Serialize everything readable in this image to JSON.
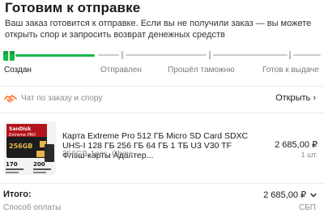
{
  "header": {
    "title": "Готовим к отправке",
    "subtitle": "Ваш заказ готовится к отправке. Если вы не получили заказ — вы можете открыть спор и запросить возврат денежных средств"
  },
  "progress": {
    "steps": [
      {
        "label": "Создан",
        "state": "done"
      },
      {
        "label": "Отправлен",
        "state": "pending"
      },
      {
        "label": "Прошёл таможню",
        "state": "pending"
      },
      {
        "label": "Готов к выдаче",
        "state": "pending"
      }
    ],
    "done_color": "#19b84a",
    "pending_color": "#c9cdd2"
  },
  "chat": {
    "label": "Чат по заказу и спору",
    "action": "Открыть",
    "icon": "handshake-icon",
    "icon_color": "#ff6a1a"
  },
  "product": {
    "name": "Карта Extreme Pro 512 ГБ Micro SD Card SDXC UHS-I 128 ГБ 256 ГБ 64 ГБ 1 ТБ U3 V30 TF Флэш-карты Адаптер...",
    "variant": "256GB-1pcs, China",
    "price": "2 685,00 ₽",
    "quantity": "1 шт.",
    "thumb": {
      "brand": "SanDisk",
      "line": "Extreme PRO",
      "capacity": "256GB",
      "read_speed": "170",
      "write_speed": "200"
    }
  },
  "summary": {
    "total_label": "Итого:",
    "total_value": "2 685,00 ₽",
    "payment_label": "Способ оплаты",
    "payment_value": "СБП"
  }
}
